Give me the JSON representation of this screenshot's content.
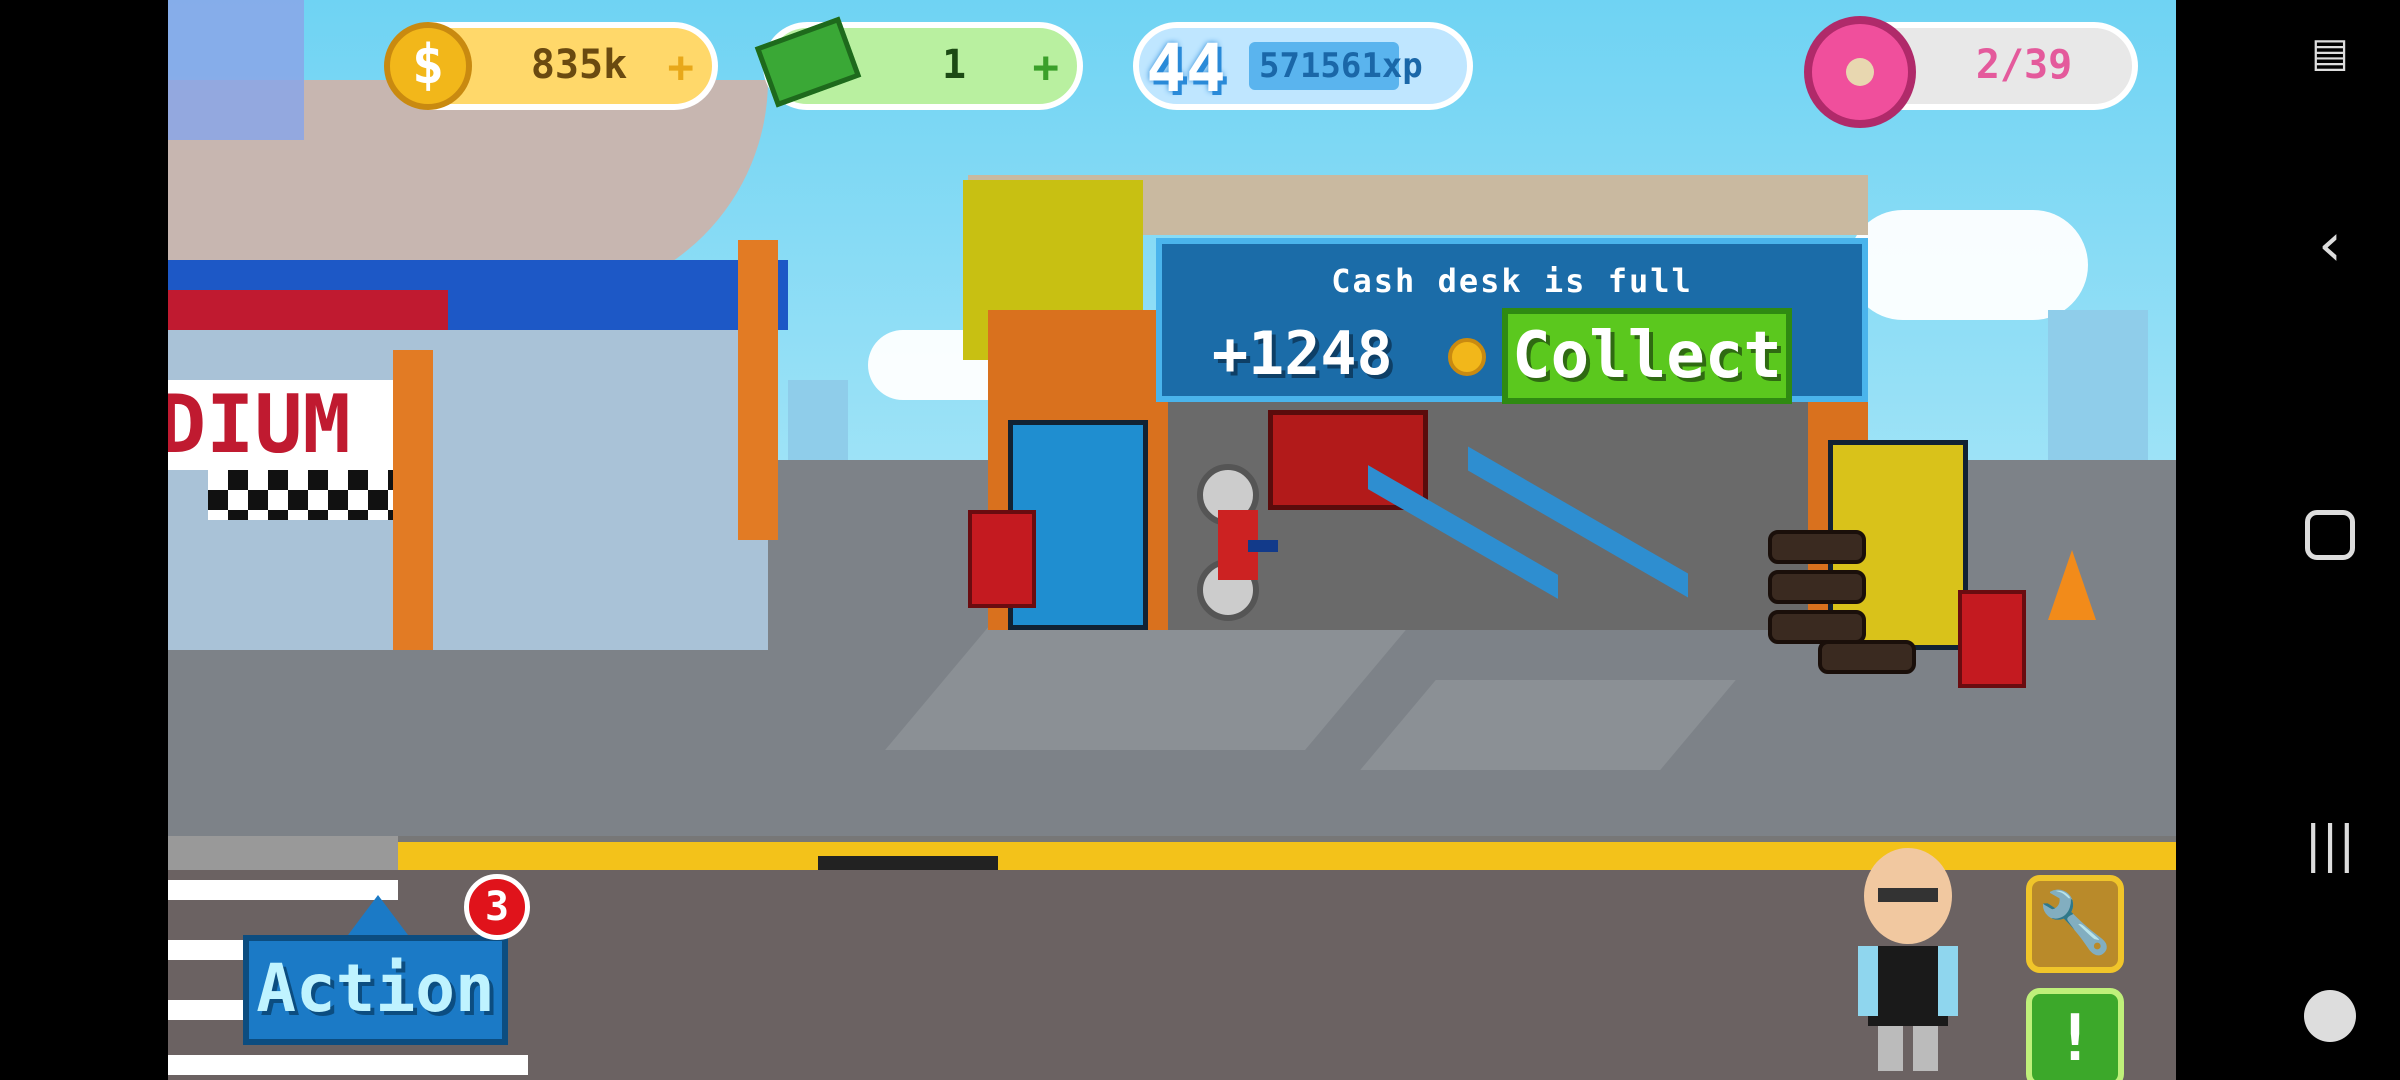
{
  "hud": {
    "coins": "835k",
    "cash": "1",
    "level": "44",
    "xp": "571561xp",
    "donuts": "2/39",
    "plus_symbol": "+"
  },
  "popup": {
    "message": "Cash desk is full",
    "amount": "+1248",
    "collect_label": "Collect"
  },
  "scene": {
    "stadium_sign": "DIUM"
  },
  "controls": {
    "action_label": "Action",
    "action_badge": "3",
    "wrench_glyph": "🔧",
    "alert_glyph": "!"
  },
  "system_nav": {
    "icons": [
      "screen-lock-icon",
      "back-icon",
      "home-icon",
      "recents-icon",
      "game-launcher-icon"
    ]
  },
  "colors": {
    "sky": "#7fd6f2",
    "coin": "#f2b71a",
    "collect_green": "#5bc81e",
    "action_blue": "#1b7ac6",
    "badge_red": "#e0131b"
  }
}
